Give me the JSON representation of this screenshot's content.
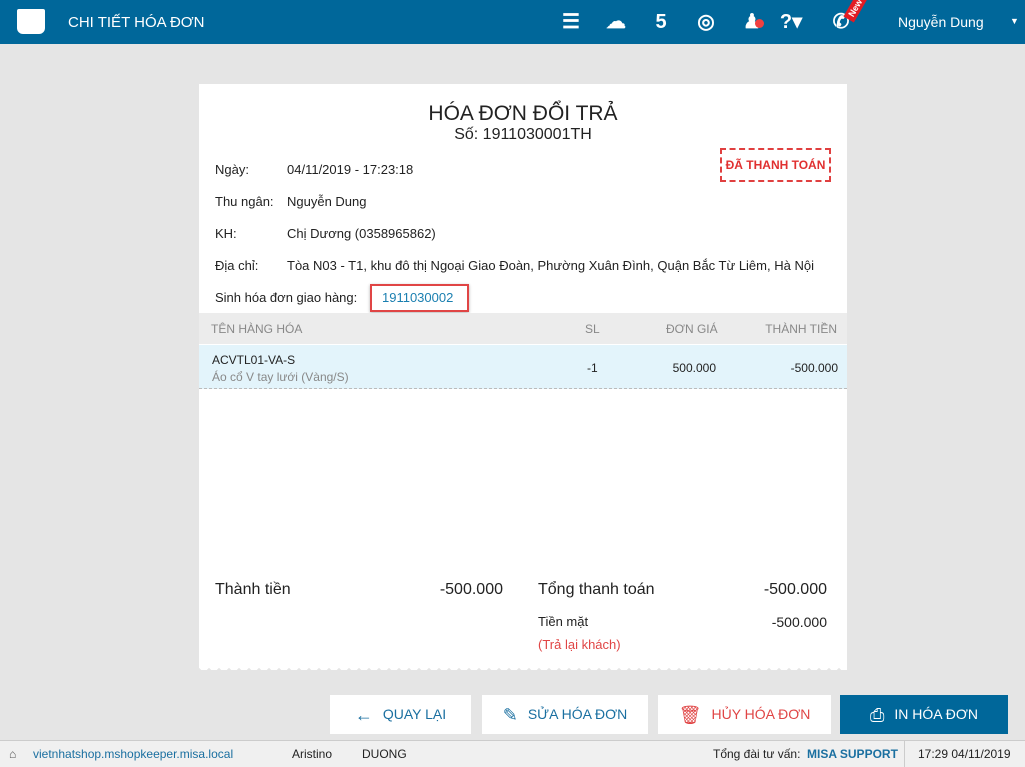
{
  "header": {
    "title": "CHI TIẾT HÓA ĐƠN",
    "user": "Nguyễn Dung",
    "new_badge": "New"
  },
  "receipt": {
    "title": "HÓA ĐƠN ĐỔI TRẢ",
    "number": "Số: 1911030001TH",
    "status": "ĐÃ THANH TOÁN",
    "fields": [
      {
        "label": "Ngày:",
        "value": "04/11/2019 - 17:23:18"
      },
      {
        "label": "Thu ngân:",
        "value": "Nguyễn Dung"
      },
      {
        "label": "KH:",
        "value": "Chị Dương (0358965862)"
      },
      {
        "label": "Địa chỉ:",
        "value": "Tòa N03 - T1, khu đô thị Ngoại Giao Đoàn, Phường Xuân Đình, Quận Bắc Từ Liêm, Hà Nội"
      }
    ],
    "delivery_label": "Sinh hóa đơn giao hàng:",
    "delivery_value": "1911030002",
    "columns": [
      "TÊN HÀNG HÓA",
      "SL",
      "ĐƠN GIÁ",
      "THÀNH TIỀN"
    ],
    "items": [
      {
        "code": "ACVTL01-VA-S",
        "name": "Áo cổ V tay lưới (Vàng/S)",
        "qty": "-1",
        "price": "500.000",
        "total": "-500.000"
      }
    ],
    "subtotal_label": "Thành tiền",
    "subtotal": "-500.000",
    "grand_label": "Tổng thanh toán",
    "grand": "-500.000",
    "cash_label": "Tiền mặt",
    "cash": "-500.000",
    "refund_note": "(Trả lại khách)"
  },
  "buttons": {
    "back": "QUAY LẠI",
    "edit": "SỬA HÓA ĐƠN",
    "cancel": "HỦY HÓA ĐƠN",
    "print": "IN HÓA ĐƠN"
  },
  "status_bar": {
    "url": "vietnhatshop.mshopkeeper.misa.local",
    "brand": "Aristino",
    "user": "DUONG",
    "hotline_label": "Tổng đài tư vấn:",
    "hotline": "MISA SUPPORT",
    "datetime": "17:29 04/11/2019"
  }
}
